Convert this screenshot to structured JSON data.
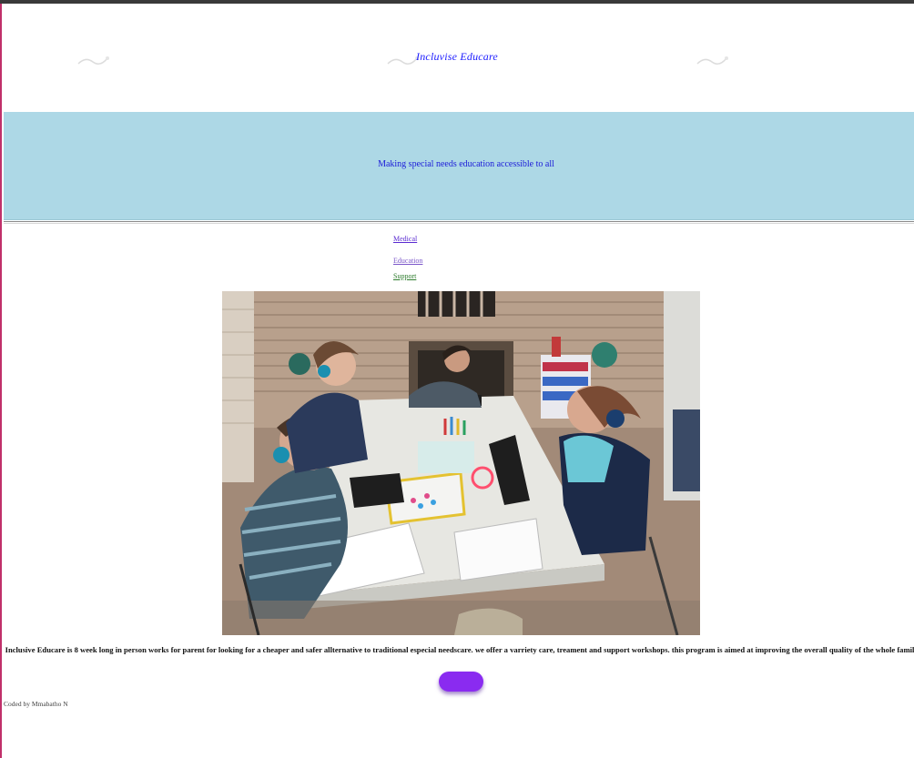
{
  "header": {
    "site_title": "Incluvise Educare",
    "watermark_icon": "small-logo-mark"
  },
  "banner": {
    "tagline": "Making special needs education accessible to all",
    "background_color": "#add8e6"
  },
  "nav": {
    "items": [
      {
        "label": "Medical"
      },
      {
        "label": "Education"
      },
      {
        "label": "Support"
      }
    ]
  },
  "main": {
    "description": "Inclusive Educare is 8 week long in person works for parent for looking for a cheaper and safer allternative to traditional especial needscare. we offer a varriety care, treament and support workshops. this program is aimed at improving the overall quality of the whole family.",
    "cta_label": ""
  },
  "footer": {
    "credit": "Coded by Mmabatho N"
  },
  "colors": {
    "accent": "#8a2bf0",
    "title": "#1a1aff",
    "left_edge": "#c0306a"
  }
}
